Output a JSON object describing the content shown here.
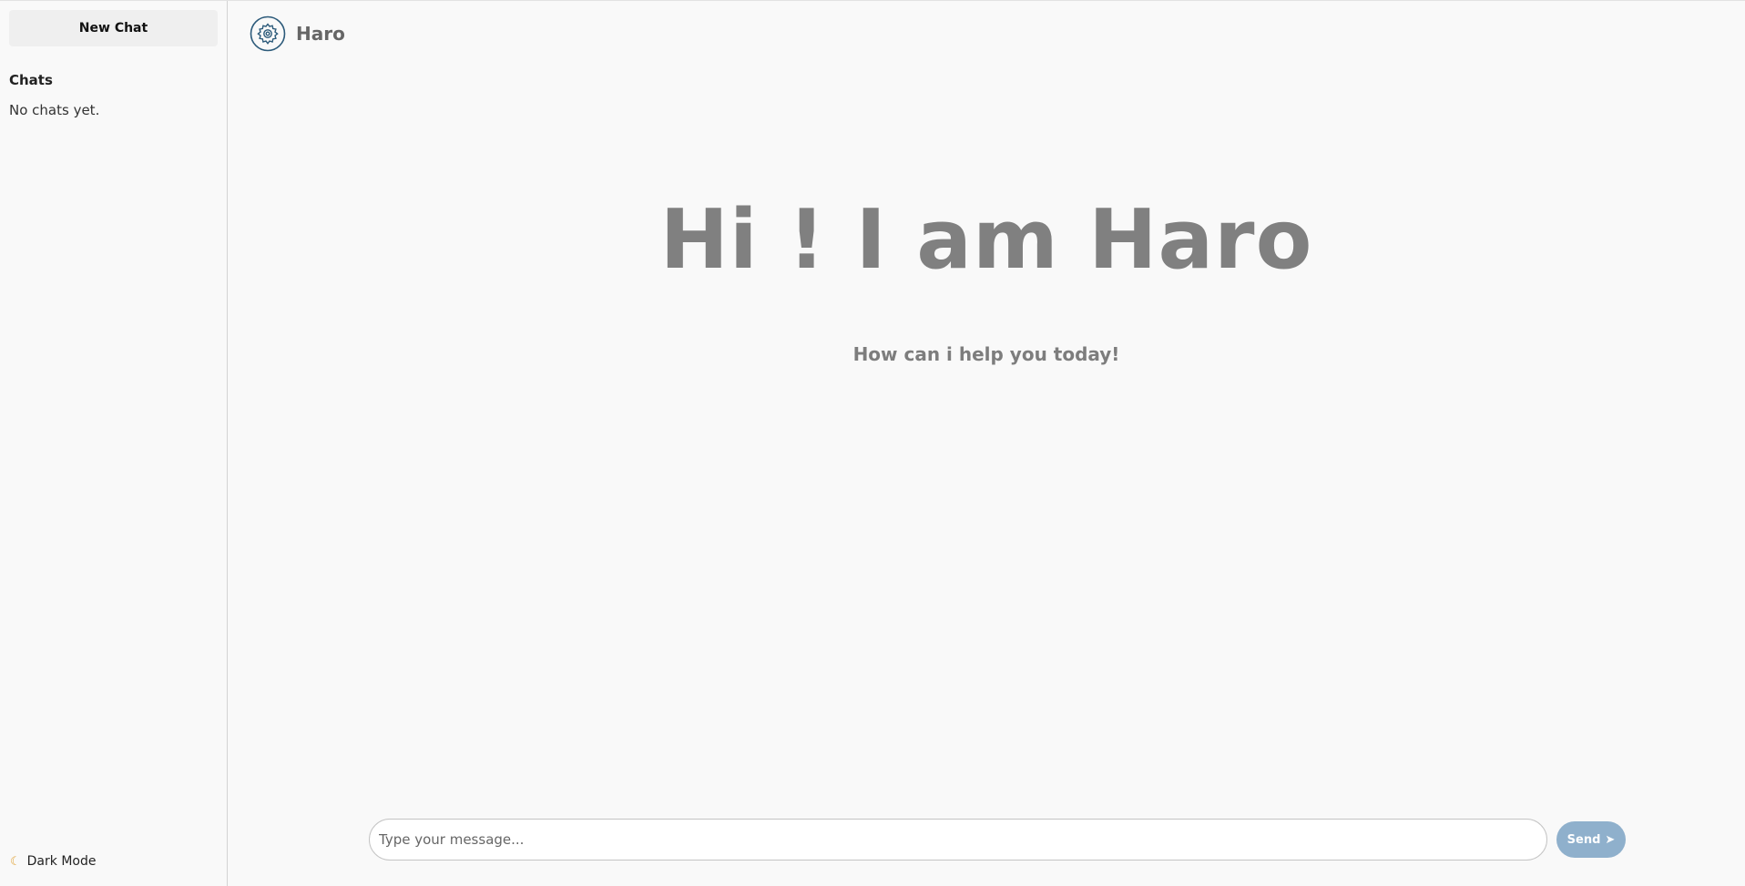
{
  "sidebar": {
    "new_chat_label": "New Chat",
    "chats_heading": "Chats",
    "empty_text": "No chats yet.",
    "dark_mode_label": "Dark Mode",
    "dark_mode_icon": "moon-icon"
  },
  "header": {
    "brand_name": "Haro",
    "logo_icon": "gear-logo-icon"
  },
  "hero": {
    "title": "Hi ! I am Haro",
    "subtitle": "How can i help you today!"
  },
  "composer": {
    "placeholder": "Type your message...",
    "value": "",
    "send_label": "Send",
    "send_icon": "paper-plane-icon"
  },
  "colors": {
    "background": "#f9f9f9",
    "send_button": "#8fb0cc",
    "logo": "#2c5a7a",
    "hero_text": "#808080"
  }
}
